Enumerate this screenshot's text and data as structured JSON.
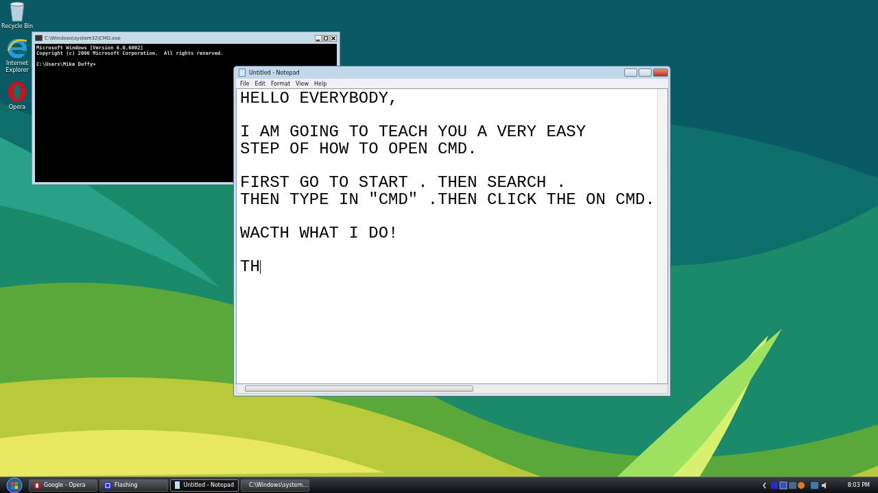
{
  "desktop_icons": [
    {
      "kind": "recycle-bin",
      "label": "Recycle Bin"
    },
    {
      "kind": "browser-e",
      "label": "Internet Explorer"
    },
    {
      "kind": "browser-o",
      "label": "Opera"
    }
  ],
  "cmd_window": {
    "title": "C:\\Windows\\system32\\CMD.exe",
    "lines": [
      "Microsoft Windows [Version 6.0.6002]",
      "Copyright (c) 2006 Microsoft Corporation.  All rights reserved."
    ],
    "prompt": "C:\\Users\\Mike Duffy>"
  },
  "notepad": {
    "title": "Untitled - Notepad",
    "menu": [
      "File",
      "Edit",
      "Format",
      "View",
      "Help"
    ],
    "paragraphs": [
      [
        "HELLO EVERYBODY,"
      ],
      [
        "I AM GOING TO TEACH YOU A VERY EASY",
        "STEP OF HOW TO OPEN CMD."
      ],
      [
        "FIRST GO TO START . THEN SEARCH .",
        "THEN TYPE IN \"CMD\" .THEN CLICK THE ON CMD."
      ],
      [
        "WACTH WHAT I DO!"
      ],
      [
        "TH"
      ]
    ]
  },
  "taskbar": {
    "buttons": [
      {
        "kind": "opera",
        "label": "Google - Opera",
        "selected": false
      },
      {
        "kind": "flash",
        "label": "Flashing",
        "selected": false
      },
      {
        "kind": "notepad",
        "label": "Untitled - Notepad",
        "selected": true
      },
      {
        "kind": "cmd",
        "label": "C:\\Windows\\system...",
        "selected": false
      }
    ],
    "clock": "8:03 PM"
  }
}
